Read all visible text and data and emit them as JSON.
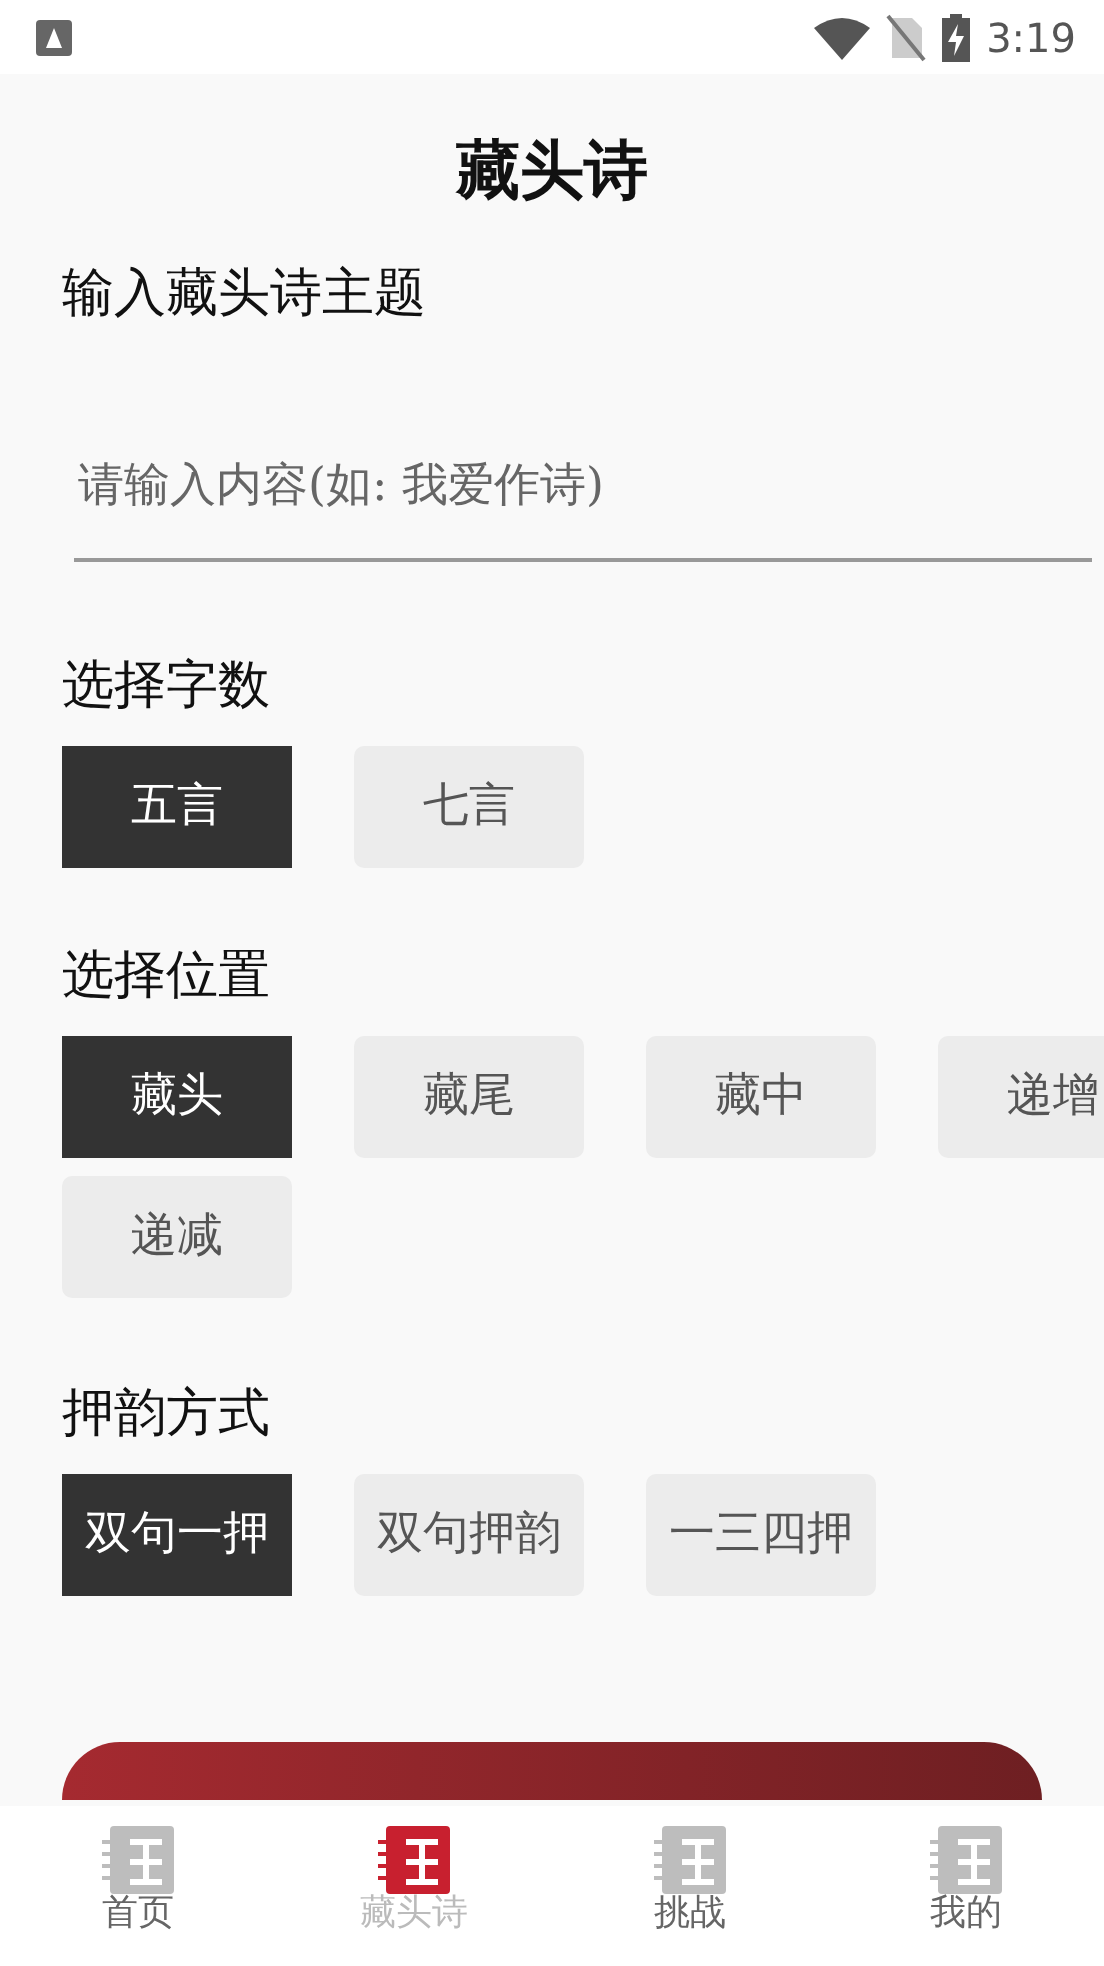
{
  "status_bar": {
    "time": "3:19"
  },
  "title": "藏头诗",
  "theme": {
    "label": "输入藏头诗主题",
    "placeholder": "请输入内容(如: 我爱作诗)"
  },
  "sections": [
    {
      "label": "选择字数",
      "options": [
        {
          "label": "五言",
          "selected": true
        },
        {
          "label": "七言",
          "selected": false
        }
      ]
    },
    {
      "label": "选择位置",
      "options": [
        {
          "label": "藏头",
          "selected": true
        },
        {
          "label": "藏尾",
          "selected": false
        },
        {
          "label": "藏中",
          "selected": false
        },
        {
          "label": "递增",
          "selected": false
        },
        {
          "label": "递减",
          "selected": false
        }
      ]
    },
    {
      "label": "押韵方式",
      "options": [
        {
          "label": "双句一押",
          "selected": true
        },
        {
          "label": "双句押韵",
          "selected": false
        },
        {
          "label": "一三四押",
          "selected": false
        }
      ]
    }
  ],
  "generate_button": {
    "kind": "primary"
  },
  "tabs": [
    {
      "label": "首页",
      "selected": false
    },
    {
      "label": "藏头诗",
      "selected": true
    },
    {
      "label": "挑战",
      "selected": false
    },
    {
      "label": "我的",
      "selected": false
    }
  ]
}
